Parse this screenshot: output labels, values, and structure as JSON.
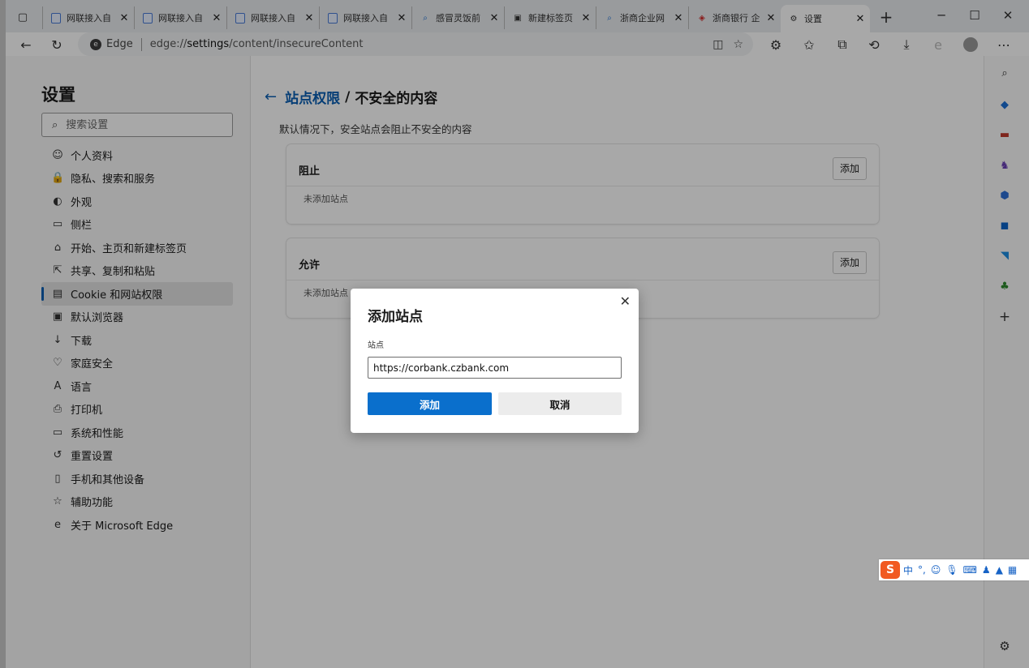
{
  "tabs": [
    {
      "title": "网联接入自",
      "icon": "page-icon"
    },
    {
      "title": "网联接入自",
      "icon": "page-icon"
    },
    {
      "title": "网联接入自",
      "icon": "page-icon"
    },
    {
      "title": "网联接入自",
      "icon": "page-icon"
    },
    {
      "title": "感冒灵饭前",
      "icon": "search-icon"
    },
    {
      "title": "新建标签页",
      "icon": "newtab-icon"
    },
    {
      "title": "浙商企业网",
      "icon": "search-icon"
    },
    {
      "title": "浙商银行 企",
      "icon": "bank-icon"
    },
    {
      "title": "设置",
      "icon": "gear-icon",
      "active": true
    }
  ],
  "address": {
    "label": "Edge",
    "url_scheme": "edge://",
    "url_host": "settings",
    "url_path": "/content/insecureContent"
  },
  "settings": {
    "title": "设置",
    "search_placeholder": "搜索设置",
    "nav": [
      {
        "label": "个人资料",
        "icon": "profile-icon"
      },
      {
        "label": "隐私、搜索和服务",
        "icon": "lock-icon"
      },
      {
        "label": "外观",
        "icon": "appearance-icon"
      },
      {
        "label": "侧栏",
        "icon": "sidebar-icon"
      },
      {
        "label": "开始、主页和新建标签页",
        "icon": "home-icon"
      },
      {
        "label": "共享、复制和粘贴",
        "icon": "share-icon"
      },
      {
        "label": "Cookie 和网站权限",
        "icon": "cookie-icon",
        "selected": true
      },
      {
        "label": "默认浏览器",
        "icon": "browser-icon"
      },
      {
        "label": "下载",
        "icon": "download-icon"
      },
      {
        "label": "家庭安全",
        "icon": "family-icon"
      },
      {
        "label": "语言",
        "icon": "language-icon"
      },
      {
        "label": "打印机",
        "icon": "printer-icon"
      },
      {
        "label": "系统和性能",
        "icon": "system-icon"
      },
      {
        "label": "重置设置",
        "icon": "reset-icon"
      },
      {
        "label": "手机和其他设备",
        "icon": "phone-icon"
      },
      {
        "label": "辅助功能",
        "icon": "accessibility-icon"
      },
      {
        "label": "关于 Microsoft Edge",
        "icon": "edge-icon"
      }
    ]
  },
  "page": {
    "breadcrumb_parent": "站点权限",
    "breadcrumb_sep": "/",
    "breadcrumb_current": "不安全的内容",
    "description": "默认情况下，安全站点会阻止不安全的内容",
    "block": {
      "heading": "阻止",
      "add_label": "添加",
      "empty": "未添加站点"
    },
    "allow": {
      "heading": "允许",
      "add_label": "添加",
      "empty": "未添加站点"
    }
  },
  "dialog": {
    "title": "添加站点",
    "field_label": "站点",
    "field_value": "https://corbank.czbank.com",
    "confirm_label": "添加",
    "cancel_label": "取消"
  },
  "ime": {
    "lang": "中",
    "punct": "°,"
  }
}
